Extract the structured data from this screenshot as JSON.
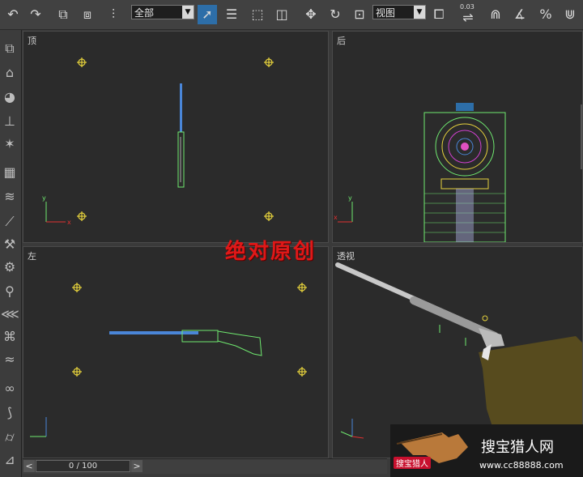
{
  "toolbar": {
    "selection_filter": "全部",
    "coordinate_system": "视图",
    "snap_value": "0.03"
  },
  "viewports": {
    "top": {
      "label": "顶"
    },
    "back": {
      "label": "后"
    },
    "left": {
      "label": "左"
    },
    "perspective": {
      "label": "透视"
    }
  },
  "watermark": "绝对原创",
  "timeline": {
    "position": "0 / 100"
  },
  "logo": {
    "badge": "搜宝猎人",
    "title": "搜宝猎人网",
    "url": "www.cc88888.com"
  },
  "colors": {
    "selection": "#2d6ea8",
    "helper_marker": "#e6d23c",
    "wireframe_green": "#6fe86f",
    "barrel_blue": "#4a86d8",
    "watermark_red": "#e01818"
  }
}
